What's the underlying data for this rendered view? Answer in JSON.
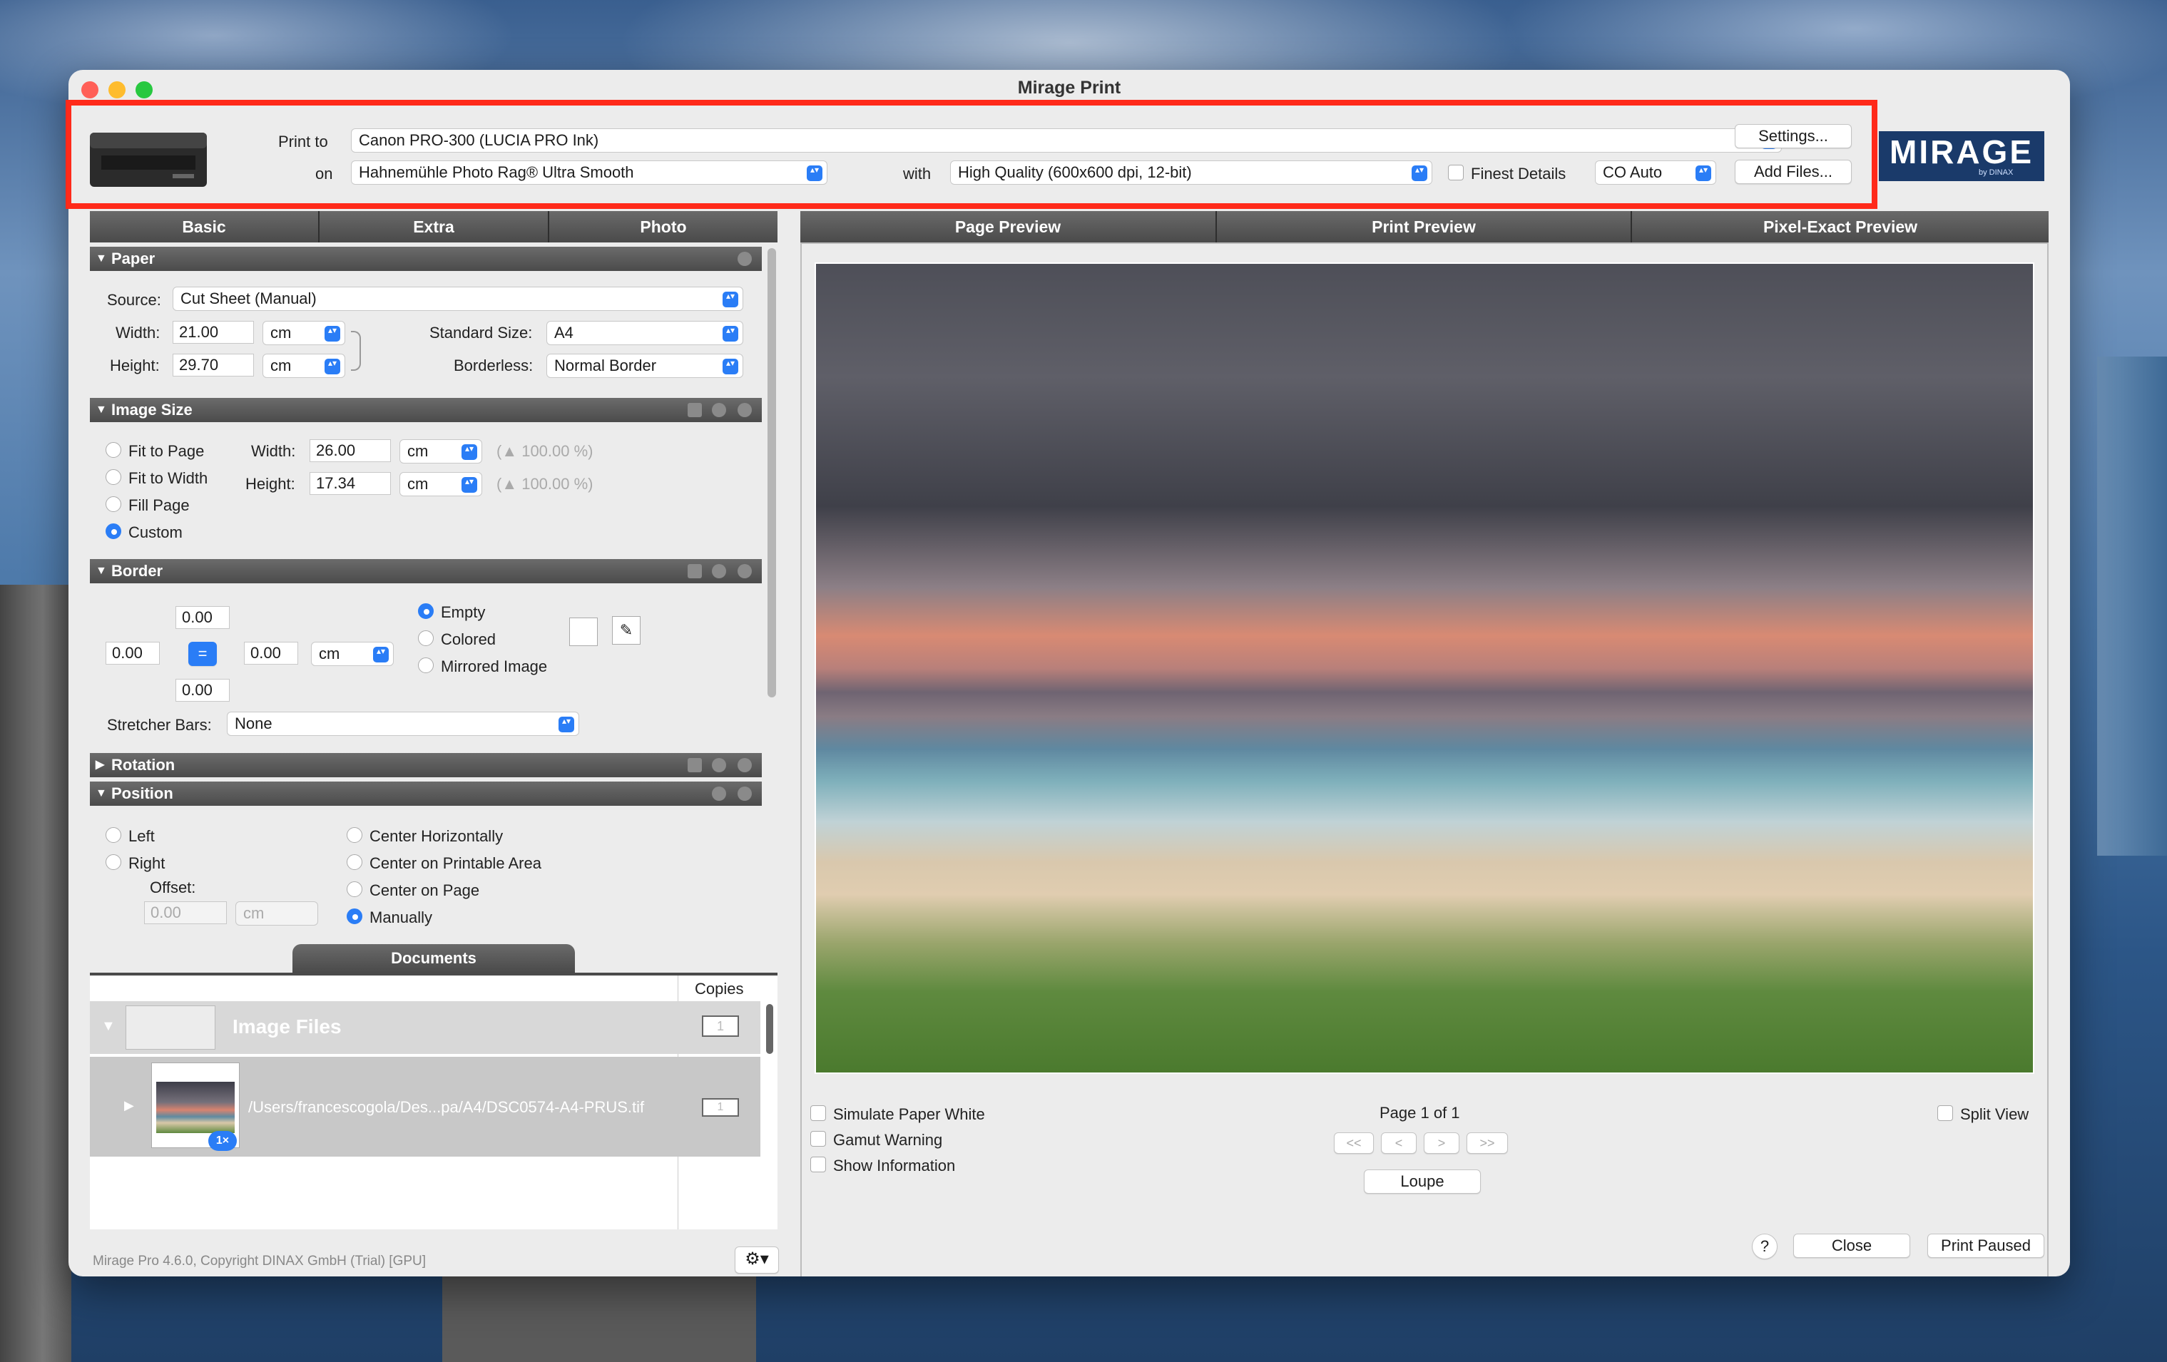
{
  "window": {
    "title": "Mirage Print"
  },
  "header": {
    "print_to_label": "Print to",
    "printer": "Canon PRO-300 (LUCIA PRO Ink)",
    "on_label": "on",
    "paper": "Hahnemühle Photo Rag® Ultra Smooth",
    "with_label": "with",
    "quality": "High Quality (600x600 dpi, 12-bit)",
    "finest_details": "Finest Details",
    "co_mode": "CO Auto",
    "settings_button": "Settings...",
    "add_files_button": "Add Files...",
    "logo": "MIRAGE",
    "logo_sub": "by DINAX"
  },
  "left_tabs": [
    "Basic",
    "Extra",
    "Photo"
  ],
  "paper": {
    "title": "Paper",
    "source_label": "Source:",
    "source": "Cut Sheet (Manual)",
    "width_label": "Width:",
    "width": "21.00",
    "width_unit": "cm",
    "height_label": "Height:",
    "height": "29.70",
    "height_unit": "cm",
    "standard_size_label": "Standard Size:",
    "standard_size": "A4",
    "borderless_label": "Borderless:",
    "borderless": "Normal Border"
  },
  "image_size": {
    "title": "Image Size",
    "options": [
      "Fit to Page",
      "Fit to Width",
      "Fill Page",
      "Custom"
    ],
    "width_label": "Width:",
    "width": "26.00",
    "width_unit": "cm",
    "width_pct": "(▲ 100.00 %)",
    "height_label": "Height:",
    "height": "17.34",
    "height_unit": "cm",
    "height_pct": "(▲ 100.00 %)"
  },
  "border": {
    "title": "Border",
    "top": "0.00",
    "left": "0.00",
    "right": "0.00",
    "bottom": "0.00",
    "link": "=",
    "unit": "cm",
    "options": [
      "Empty",
      "Colored",
      "Mirrored Image"
    ],
    "stretcher_label": "Stretcher Bars:",
    "stretcher": "None"
  },
  "rotation": {
    "title": "Rotation"
  },
  "position": {
    "title": "Position",
    "left_opts": [
      "Left",
      "Right"
    ],
    "offset_label": "Offset:",
    "offset": "0.00",
    "offset_unit": "cm",
    "center_opts": [
      "Center Horizontally",
      "Center on Printable Area",
      "Center on Page",
      "Manually"
    ]
  },
  "documents": {
    "tab": "Documents",
    "copies_header": "Copies",
    "group_label": "Image Files",
    "group_copies": "1",
    "file_path": "/Users/francescogola/Des...pa/A4/DSC0574-A4-PRUS.tif",
    "file_copies": "1",
    "file_badge": "1×"
  },
  "footer_left": {
    "copyright": "Mirage Pro 4.6.0, Copyright DINAX GmbH (Trial) [GPU]"
  },
  "preview_tabs": [
    "Page Preview",
    "Print Preview",
    "Pixel-Exact Preview"
  ],
  "preview_opts": {
    "simulate": "Simulate Paper White",
    "gamut": "Gamut Warning",
    "show_info": "Show Information",
    "page": "Page 1 of 1",
    "nav": [
      "<<",
      "<",
      ">",
      ">>"
    ],
    "loupe": "Loupe",
    "split": "Split View"
  },
  "bottom": {
    "help": "?",
    "close": "Close",
    "print": "Print Paused"
  }
}
